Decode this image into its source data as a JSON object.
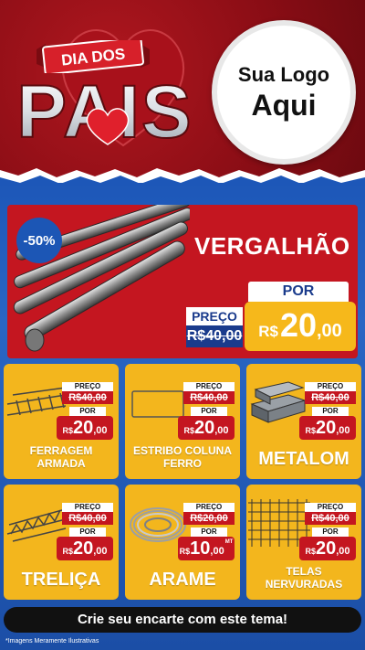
{
  "header": {
    "banner_text": "DIA DOS",
    "headline": "PAIS",
    "logo_line1": "Sua Logo",
    "logo_line2": "Aqui"
  },
  "hero": {
    "discount": "-50%",
    "title": "VERGALHÃO",
    "preco_label": "PREÇO",
    "old_price": "R$40,00",
    "por_label": "POR",
    "currency": "R$",
    "new_int": "20",
    "new_cents": ",00"
  },
  "cards": [
    {
      "name": "FERRAGEM\nARMADA",
      "preco_label": "PREÇO",
      "old_price": "R$40,00",
      "por_label": "POR",
      "currency": "R$",
      "new_int": "20",
      "new_cents": ",00"
    },
    {
      "name": "ESTRIBO COLUNA\nFERRO",
      "preco_label": "PREÇO",
      "old_price": "R$40,00",
      "por_label": "POR",
      "currency": "R$",
      "new_int": "20",
      "new_cents": ",00"
    },
    {
      "name": "METALOM",
      "preco_label": "PREÇO",
      "old_price": "R$40,00",
      "por_label": "POR",
      "currency": "R$",
      "new_int": "20",
      "new_cents": ",00"
    },
    {
      "name": "TRELIÇA",
      "preco_label": "PREÇO",
      "old_price": "R$40,00",
      "por_label": "POR",
      "currency": "R$",
      "new_int": "20",
      "new_cents": ",00"
    },
    {
      "name": "ARAME",
      "preco_label": "PREÇO",
      "old_price": "R$20,00",
      "por_label": "POR",
      "currency": "R$",
      "new_int": "10",
      "new_cents": ",00",
      "unit": "MT"
    },
    {
      "name": "TELAS\nNERVURADAS",
      "preco_label": "PREÇO",
      "old_price": "R$40,00",
      "por_label": "POR",
      "currency": "R$",
      "new_int": "20",
      "new_cents": ",00"
    }
  ],
  "cta": "Crie seu encarte com este tema!",
  "footnote": "*Imagens Meramente Ilustrativas",
  "colors": {
    "red": "#c41620",
    "blue": "#1d57b8",
    "yellow": "#f3b61d",
    "navy": "#1a3b8c"
  }
}
